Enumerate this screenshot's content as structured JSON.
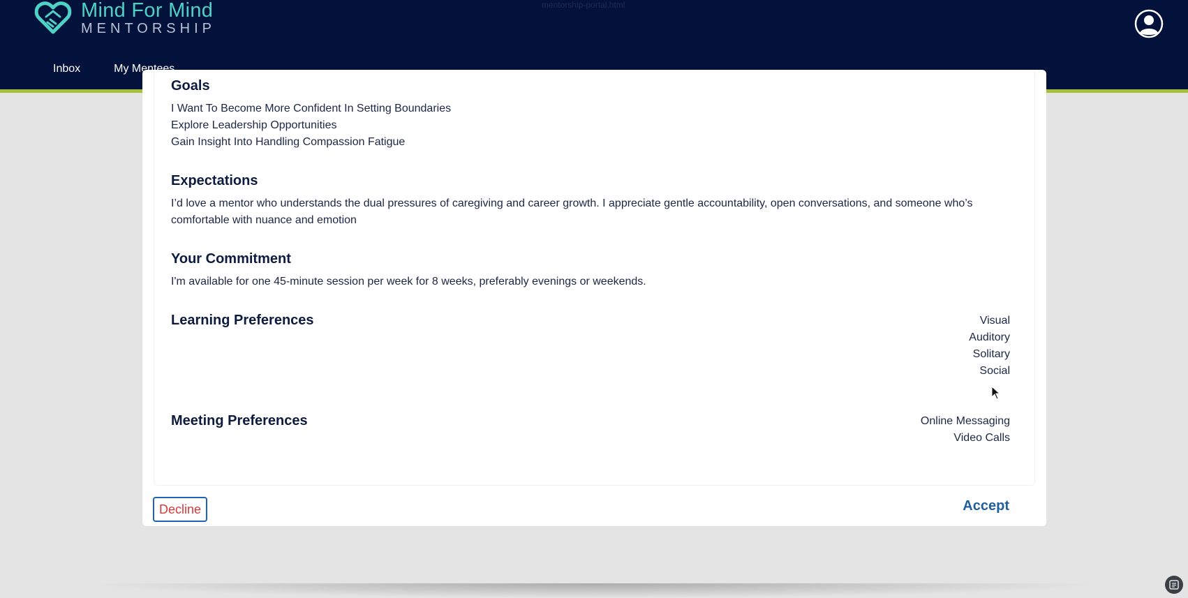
{
  "app": {
    "logo_title": "Mind For Mind",
    "logo_subtitle": "MENTORSHIP",
    "top_doc_label": "mentorship-portal.html",
    "nav": [
      {
        "label": "Inbox"
      },
      {
        "label": "My Mentees"
      }
    ]
  },
  "modal": {
    "goals": {
      "title": "Goals",
      "items": [
        "I Want To Become More Confident In Setting Boundaries",
        "Explore Leadership Opportunities",
        "Gain Insight Into Handling Compassion Fatigue"
      ]
    },
    "expectations": {
      "title": "Expectations",
      "lines": [
        "I’d love a mentor who understands the dual pressures of caregiving and career growth. I appreciate gentle accountability, open conversations, and someone who’s",
        "comfortable with nuance and emotion"
      ]
    },
    "commitment": {
      "title": "Your Commitment",
      "text": "I'm available for one 45-minute session per week for 8 weeks, preferably evenings or weekends."
    },
    "learning": {
      "title": "Learning Preferences",
      "items": [
        "Visual",
        "Auditory",
        "Solitary",
        "Social"
      ]
    },
    "meeting": {
      "title": "Meeting Preferences",
      "items": [
        "Online Messaging",
        "Video Calls"
      ]
    },
    "decline_label": "Decline",
    "accept_label": "Accept"
  },
  "colors": {
    "header_bg": "#03123a",
    "accent_stripe": "#a6c03a",
    "logo_teal": "#4fd1c5",
    "decline_text": "#d33a3a",
    "accept_text": "#1e5f9c"
  }
}
